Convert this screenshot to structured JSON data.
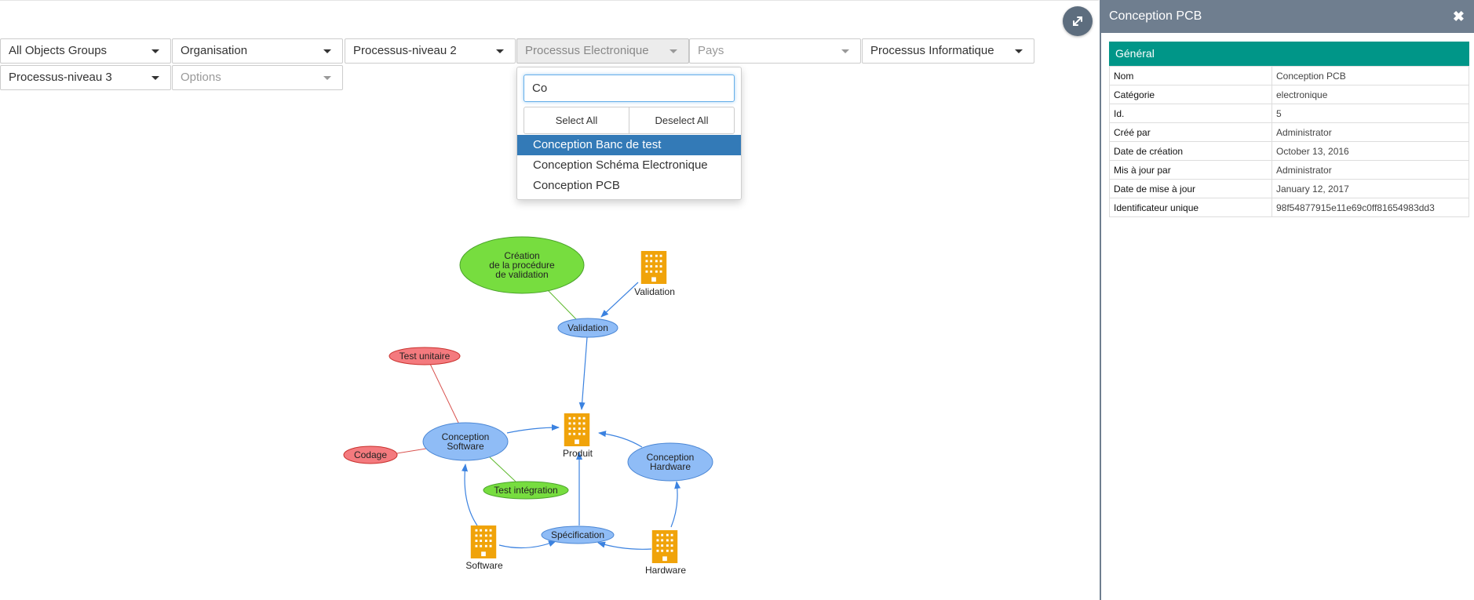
{
  "filters": [
    {
      "label": "All Objects Groups",
      "placeholder": false
    },
    {
      "label": "Organisation",
      "placeholder": false
    },
    {
      "label": "Processus-niveau 2",
      "placeholder": false
    },
    {
      "label": "Processus Electronique",
      "placeholder": false,
      "open": true
    },
    {
      "label": "Pays",
      "placeholder": true
    },
    {
      "label": "Processus Informatique",
      "placeholder": false
    },
    {
      "label": "Processus-niveau 3",
      "placeholder": false
    },
    {
      "label": "Options",
      "placeholder": true
    }
  ],
  "dropdown": {
    "search_value": "Co",
    "select_all": "Select All",
    "deselect_all": "Deselect All",
    "options": [
      "Conception Banc de test",
      "Conception Schéma Electronique",
      "Conception PCB"
    ],
    "highlighted": "Conception Banc de test"
  },
  "expand_icon": "expand-arrows-icon",
  "graph": {
    "nodes": {
      "creation": [
        "Création",
        "de la procédure",
        "de validation"
      ],
      "validation_icon": "Validation",
      "validation": "Validation",
      "test_unitaire": "Test unitaire",
      "conception_software": [
        "Conception",
        "Software"
      ],
      "produit": "Produit",
      "conception_hardware": [
        "Conception",
        "Hardware"
      ],
      "codage": "Codage",
      "test_integration": "Test intégration",
      "specification": "Spécification",
      "software": "Software",
      "hardware": "Hardware"
    },
    "colors": {
      "blue": "#8fbcf6",
      "green": "#77dd3f",
      "red": "#f47a7e",
      "building": "#f0a30a",
      "edge": "#3b82e0"
    }
  },
  "panel": {
    "title": "Conception PCB",
    "close_icon": "close-icon",
    "section": "Général",
    "rows": [
      {
        "key": "Nom",
        "value": "Conception PCB"
      },
      {
        "key": "Catégorie",
        "value": "electronique"
      },
      {
        "key": "Id.",
        "value": "5"
      },
      {
        "key": "Créé par",
        "value": "Administrator"
      },
      {
        "key": "Date de création",
        "value": "October 13, 2016"
      },
      {
        "key": "Mis à jour par",
        "value": "Administrator"
      },
      {
        "key": "Date de mise à jour",
        "value": "January 12, 2017"
      },
      {
        "key": "Identificateur unique",
        "value": "98f54877915e11e69c0ff81654983dd3"
      }
    ],
    "accent": "#009688",
    "header_color": "#6f7e8f"
  }
}
